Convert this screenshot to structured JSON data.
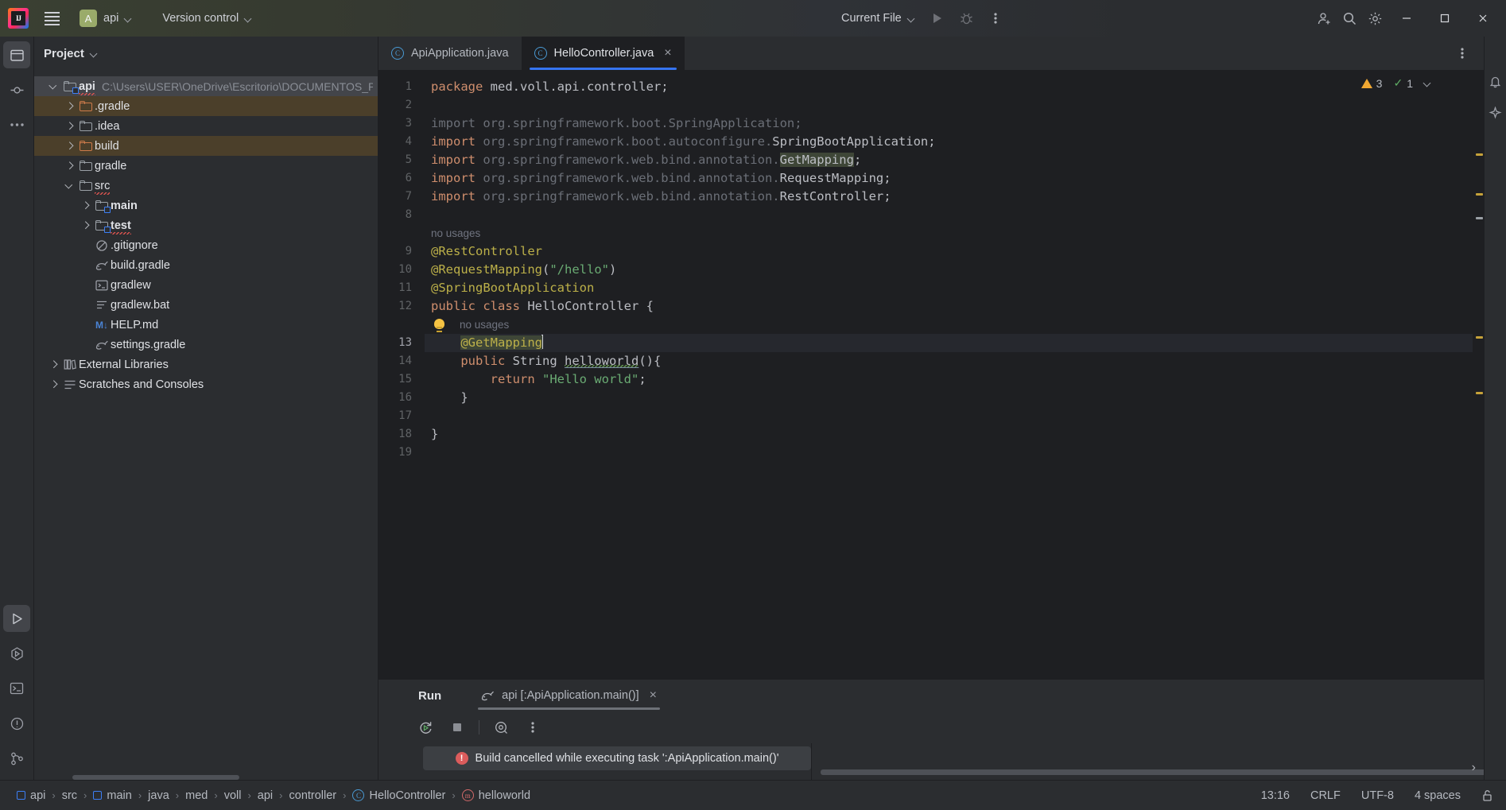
{
  "titlebar": {
    "app_logo": "intellij-idea-logo",
    "menu_icon": "hamburger-menu-icon",
    "project_initial": "A",
    "project_name": "api",
    "version_control": "Version control",
    "run_config": "Current File",
    "run_icon": "run-icon",
    "debug_icon": "debug-icon",
    "more_icon": "more-options-icon",
    "account_icon": "account-icon",
    "search_icon": "search-icon",
    "settings_icon": "settings-icon",
    "minimize": "minimize-icon",
    "maximize": "maximize-icon",
    "close": "close-icon"
  },
  "left_rail": {
    "project_tool": "project-tool-icon",
    "commit_tool": "commit-tool-icon",
    "more_tool": "more-tool-windows-icon",
    "run_tool": "run-tool-icon",
    "services_tool": "services-tool-icon",
    "terminal_tool": "terminal-tool-icon",
    "problems_tool": "problems-tool-icon",
    "git_tool": "version-control-tool-icon"
  },
  "project_pane": {
    "title": "Project",
    "tree": [
      {
        "label": "api",
        "path": "C:\\Users\\USER\\OneDrive\\Escritorio\\DOCUMENTOS_PE",
        "indent": 0,
        "arrow": "open",
        "icon": "module-folder",
        "state": "selected",
        "bold": true,
        "spell": true
      },
      {
        "label": ".gradle",
        "path": "",
        "indent": 1,
        "arrow": "closed",
        "icon": "folder-orange",
        "state": "excluded",
        "bold": false,
        "spell": false
      },
      {
        "label": ".idea",
        "path": "",
        "indent": 1,
        "arrow": "closed",
        "icon": "folder",
        "state": "",
        "bold": false,
        "spell": false
      },
      {
        "label": "build",
        "path": "",
        "indent": 1,
        "arrow": "closed",
        "icon": "folder-orange",
        "state": "excluded",
        "bold": false,
        "spell": false
      },
      {
        "label": "gradle",
        "path": "",
        "indent": 1,
        "arrow": "closed",
        "icon": "folder",
        "state": "",
        "bold": false,
        "spell": false
      },
      {
        "label": "src",
        "path": "",
        "indent": 1,
        "arrow": "open",
        "icon": "folder",
        "state": "",
        "bold": false,
        "spell": true
      },
      {
        "label": "main",
        "path": "",
        "indent": 2,
        "arrow": "closed",
        "icon": "source-folder",
        "state": "",
        "bold": true,
        "spell": false
      },
      {
        "label": "test",
        "path": "",
        "indent": 2,
        "arrow": "closed",
        "icon": "test-folder",
        "state": "",
        "bold": true,
        "spell": true
      },
      {
        "label": ".gitignore",
        "path": "",
        "indent": 2,
        "arrow": "none",
        "icon": "gitignore-file",
        "state": "",
        "bold": false,
        "spell": false
      },
      {
        "label": "build.gradle",
        "path": "",
        "indent": 2,
        "arrow": "none",
        "icon": "gradle-file",
        "state": "",
        "bold": false,
        "spell": false
      },
      {
        "label": "gradlew",
        "path": "",
        "indent": 2,
        "arrow": "none",
        "icon": "shell-file",
        "state": "",
        "bold": false,
        "spell": false
      },
      {
        "label": "gradlew.bat",
        "path": "",
        "indent": 2,
        "arrow": "none",
        "icon": "text-file",
        "state": "",
        "bold": false,
        "spell": false
      },
      {
        "label": "HELP.md",
        "path": "",
        "indent": 2,
        "arrow": "none",
        "icon": "markdown-file",
        "state": "",
        "bold": false,
        "spell": false
      },
      {
        "label": "settings.gradle",
        "path": "",
        "indent": 2,
        "arrow": "none",
        "icon": "gradle-file",
        "state": "",
        "bold": false,
        "spell": false
      },
      {
        "label": "External Libraries",
        "path": "",
        "indent": 0,
        "arrow": "closed",
        "icon": "library-icon",
        "state": "",
        "bold": false,
        "spell": false
      },
      {
        "label": "Scratches and Consoles",
        "path": "",
        "indent": 0,
        "arrow": "closed",
        "icon": "scratches-icon",
        "state": "",
        "bold": false,
        "spell": false
      }
    ]
  },
  "editor": {
    "tabs": [
      {
        "label": "ApiApplication.java",
        "active": false,
        "closable": false
      },
      {
        "label": "HelloController.java",
        "active": true,
        "closable": true
      }
    ],
    "tab_options_icon": "editor-options-icon",
    "inspections": {
      "warning_count": "3",
      "ok_count": "1",
      "warn_icon": "warning-icon",
      "check_icon": "checkmark-icon",
      "collapse_icon": "chevron-down-icon"
    },
    "gutter_lines": [
      "1",
      "2",
      "3",
      "4",
      "5",
      "6",
      "7",
      "8",
      "9",
      "10",
      "11",
      "12",
      "13",
      "14",
      "15",
      "16",
      "17",
      "18",
      "19"
    ],
    "current_line": 13,
    "hints": {
      "class_no_usages": "no usages",
      "method_no_usages": "no usages"
    },
    "code": {
      "l1_kw": "package",
      "l1_rest": " med.voll.api.controller;",
      "l3": "import org.springframework.boot.SpringApplication;",
      "l4_kw": "import",
      "l4_pkg": " org.springframework.boot.autoconfigure.",
      "l4_cls": "SpringBootApplication",
      "l4_end": ";",
      "l5_kw": "import",
      "l5_pkg": " org.springframework.web.bind.annotation.",
      "l5_cls": "GetMapping",
      "l5_end": ";",
      "l6_kw": "import",
      "l6_pkg": " org.springframework.web.bind.annotation.",
      "l6_cls": "RequestMapping",
      "l6_end": ";",
      "l7_kw": "import",
      "l7_pkg": " org.springframework.web.bind.annotation.",
      "l7_cls": "RestController",
      "l7_end": ";",
      "l9": "@RestController",
      "l10_ann": "@RequestMapping",
      "l10_p1": "(",
      "l10_str": "\"/hello\"",
      "l10_p2": ")",
      "l11": "@SpringBootApplication",
      "l12_kw": "public class",
      "l12_name": " HelloController ",
      "l12_brace": "{",
      "l13": "@GetMapping",
      "l14_kw": "public",
      "l14_type": " String ",
      "l14_mtd": "helloworld",
      "l14_end": "(){",
      "l15_kw": "return",
      "l15_str": " \"Hello world\"",
      "l15_end": ";",
      "l16": "}",
      "l18": "}"
    }
  },
  "run_panel": {
    "title": "Run",
    "tab_label": "api [:ApiApplication.main()]",
    "tab_icon": "gradle-icon",
    "tab_close": "close-icon",
    "toolbar": {
      "rerun": "rerun-icon",
      "stop": "stop-icon",
      "filter": "filter-output-icon",
      "more": "more-options-icon"
    },
    "build_message": "Build cancelled while executing task ':ApiApplication.main()'",
    "build_message_icon": "error-icon",
    "expand_icon": "expand-right-icon"
  },
  "status_bar": {
    "breadcrumbs": [
      {
        "label": "api",
        "icon": "module-icon"
      },
      {
        "label": "src",
        "icon": "none"
      },
      {
        "label": "main",
        "icon": "module-icon"
      },
      {
        "label": "java",
        "icon": "none"
      },
      {
        "label": "med",
        "icon": "none"
      },
      {
        "label": "voll",
        "icon": "none"
      },
      {
        "label": "api",
        "icon": "none"
      },
      {
        "label": "controller",
        "icon": "none"
      },
      {
        "label": "HelloController",
        "icon": "class-icon"
      },
      {
        "label": "helloworld",
        "icon": "method-icon"
      }
    ],
    "separator": "›",
    "caret_position": "13:16",
    "line_separator": "CRLF",
    "encoding": "UTF-8",
    "indent": "4 spaces",
    "lock_icon": "read-only-lock-icon"
  },
  "colors": {
    "accent_blue": "#3574f0",
    "annotation": "#bcb049",
    "keyword": "#cf8e6d",
    "string": "#6aab73",
    "editor_bg": "#1e1f22",
    "panel_bg": "#2b2d30",
    "excluded_row": "#4b3f2a",
    "selected_row": "#43454a"
  }
}
